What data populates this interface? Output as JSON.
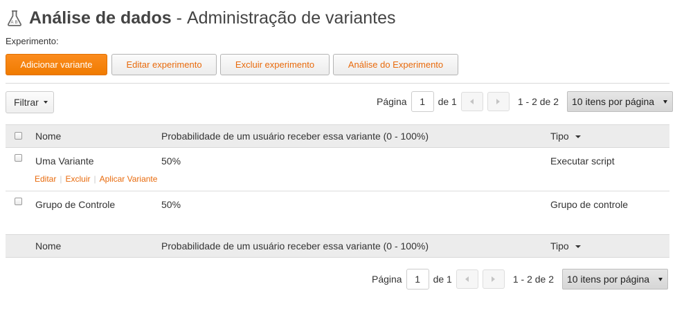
{
  "header": {
    "icon": "flask-icon",
    "title": "Análise de dados",
    "separator": "-",
    "subtitle": "Administração de variantes",
    "experiment_label": "Experimento:"
  },
  "toolbar": {
    "add_variant": "Adicionar variante",
    "edit_experiment": "Editar experimento",
    "delete_experiment": "Excluir experimento",
    "experiment_analysis": "Análise do Experimento"
  },
  "filter": {
    "label": "Filtrar"
  },
  "pager": {
    "page_label": "Página",
    "page_value": "1",
    "of_label": "de 1",
    "range": "1 - 2 de 2",
    "per_page": "10 itens por página"
  },
  "table": {
    "headers": {
      "name": "Nome",
      "probability": "Probabilidade de um usuário receber essa variante (0 - 100%)",
      "type": "Tipo"
    },
    "rows": [
      {
        "name": "Uma Variante",
        "probability": "50%",
        "type": "Executar script",
        "actions": [
          "Editar",
          "Excluir",
          "Aplicar Variante"
        ]
      },
      {
        "name": "Grupo de Controle",
        "probability": "50%",
        "type": "Grupo de controle"
      }
    ]
  },
  "colors": {
    "accent": "#f07b00",
    "link": "#e86a0c",
    "header_bg": "#ececec"
  }
}
